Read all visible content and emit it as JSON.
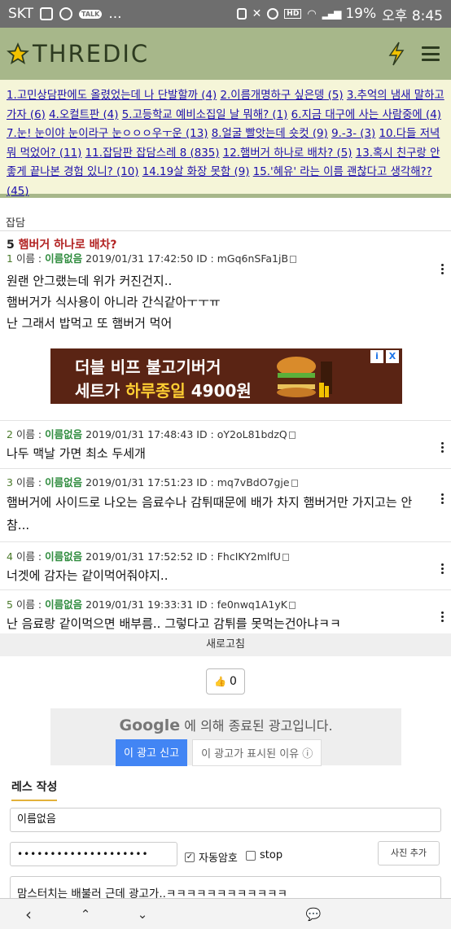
{
  "status_bar": {
    "carrier": "SKT",
    "dots": "...",
    "talk_badge": "TALK",
    "hd_badge": "HD",
    "battery": "19%",
    "time": "오후 8:45"
  },
  "header": {
    "logo_text": "THREDIC"
  },
  "thread_list": [
    "1.고민상담판에도 올렸었는데 나 단발할까 (4)",
    "2.이름개명하구 싶은뎅 (5)",
    "3.추억의 냄새 말하고가자 (6)",
    "4.오컬트판 (4)",
    "5.고등학교 예비소집일 날 뭐해? (1)",
    "6.지금 대구에 사는 사람중에 (4)",
    "7.눈! 눈이야 눈이라구 눈ㅇㅇㅇ우ㅜ운 (13)",
    "8.얼굴 빨앗는데 숏컷 (9)",
    "9.-3- (3)",
    "10.다들 저녁 뭐 먹었어? (11)",
    "11.잡담판 잡담스레 8 (835)",
    "12.햄버거 하나로 배차? (5)",
    "13.혹시 친구랑 안좋게 끝나본 경험 있니? (10)",
    "14.19살 화장 못함 (9)",
    "15.'혜유' 라는 이름 괜찮다고 생각해?? (45)"
  ],
  "board": {
    "name": "잡담",
    "thread_num": "5",
    "thread_title": "햄버거 하나로 배차?"
  },
  "posts": [
    {
      "num": "1",
      "name_label": "이름 :",
      "name": "이름없음",
      "date": "2019/01/31 17:42:50",
      "id": "ID : mGq6nSFa1jB",
      "lines": [
        "원랜 안그랬는데 위가 커진건지..",
        "햄버거가 식사용이 아니라 간식같아ㅜㅜㅠ",
        "난 그래서 밥먹고 또 햄버거 먹어"
      ]
    },
    {
      "num": "2",
      "name_label": "이름 :",
      "name": "이름없음",
      "date": "2019/01/31 17:48:43",
      "id": "ID : oY2oL81bdzQ",
      "lines": [
        "나두 맥날 가면 최소 두세개"
      ]
    },
    {
      "num": "3",
      "name_label": "이름 :",
      "name": "이름없음",
      "date": "2019/01/31 17:51:23",
      "id": "ID : mq7vBdO7gje",
      "lines": [
        "햄버거에 사이드로 나오는 음료수나 감튀때문에 배가 차지 햄버거만 가지고는 안",
        "참..."
      ]
    },
    {
      "num": "4",
      "name_label": "이름 :",
      "name": "이름없음",
      "date": "2019/01/31 17:52:52",
      "id": "ID : FhcIKY2mlfU",
      "lines": [
        "너겟에 감자는 같이먹어줘야지.."
      ]
    },
    {
      "num": "5",
      "name_label": "이름 :",
      "name": "이름없음",
      "date": "2019/01/31 19:33:31",
      "id": "ID : fe0nwq1A1yK",
      "lines": [
        "난 음료랑 같이먹으면 배부름.. 그렇다고 감튀를 못먹는건아냐ㅋㅋ"
      ]
    }
  ],
  "ad_banner": {
    "line1": "더블 비프 불고기버거",
    "line2_a": "세트가",
    "line2_b": "하루종일",
    "line2_c": "4900원",
    "info": "i",
    "close": "X"
  },
  "refresh_label": "새로고침",
  "like": {
    "icon": "👍",
    "count": "0"
  },
  "google_ad": {
    "brand": "Google",
    "message": "에 의해 종료된 광고입니다.",
    "report_button": "이 광고 신고",
    "why_button": "이 광고가 표시된 이유 ⓘ"
  },
  "reply_form": {
    "tab": "레스 작성",
    "name_value": "이름없음",
    "password_mask": "••••••••••••••••••••",
    "auto_password_label": "자동암호",
    "auto_password_checked": true,
    "stop_label": "stop",
    "stop_checked": false,
    "photo_button": "사진 추가",
    "content_value": "맘스터치는 배불러 근데 광고가..ㅋㅋㅋㅋㅋㅋㅋㅋㅋㅋㅋㅋ"
  },
  "nav": {
    "back": "‹",
    "up": "⌃",
    "down": "⌄",
    "chat": "💬"
  },
  "colors": {
    "header_bg": "#a7b78a",
    "thread_list_bg": "#f5f5d8",
    "thread_title": "#b22222",
    "name_green": "#2e8b3d",
    "google_blue": "#4285f4"
  }
}
